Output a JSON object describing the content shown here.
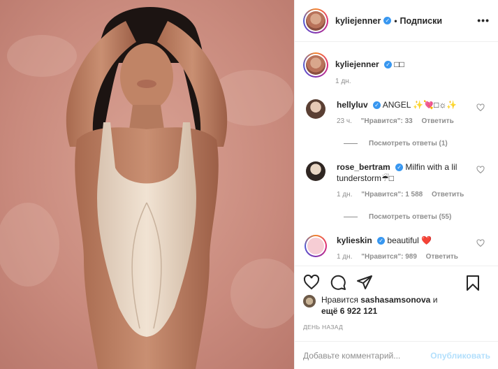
{
  "header": {
    "username": "kyliejenner",
    "separator": "•",
    "follow_label": "Подписки",
    "more_label": "•••"
  },
  "caption": {
    "username": "kyliejenner",
    "text": "□□",
    "time": "1 дн."
  },
  "comments": [
    {
      "username": "hellyluv",
      "text": "ANGEL ✨💘□☼️✨",
      "time": "23 ч.",
      "likes": "\"Нравится\": 33",
      "reply_label": "Ответить",
      "view_replies": "Посмотреть ответы (1)"
    },
    {
      "username": "rose_bertram",
      "text": "Milfin with a lil tunderstorm☔□",
      "time": "1 дн.",
      "likes": "\"Нравится\": 1 588",
      "reply_label": "Ответить",
      "view_replies": "Посмотреть ответы (55)"
    },
    {
      "username": "kylieskin",
      "text": "beautiful ❤️",
      "time": "1 дн.",
      "likes": "\"Нравится\": 989",
      "reply_label": "Ответить"
    }
  ],
  "likes": {
    "prefix": "Нравится",
    "user": "sashasamsonova",
    "conj": "и",
    "more": "ещё 6 922 121"
  },
  "date": "ДЕНЬ НАЗАД",
  "add_comment": {
    "placeholder": "Добавьте комментарий...",
    "publish_label": "Опубликовать"
  },
  "colors": {
    "verified": "#3897f0",
    "publish": "#b2dffc",
    "muted": "#8e8e8e",
    "heart_red": "#ed4956"
  }
}
